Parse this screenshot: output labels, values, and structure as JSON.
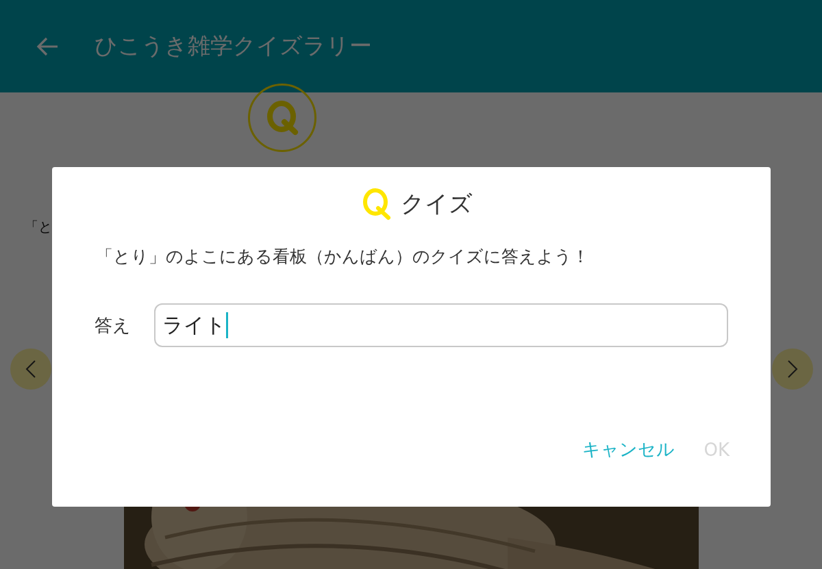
{
  "app_bar": {
    "title": "ひこうき雑学クイズラリー"
  },
  "page": {
    "lead_text": "「と"
  },
  "dialog": {
    "title": "クイズ",
    "question": "「とり」のよこにある看板（かんばん）のクイズに答えよう！",
    "answer_label": "答え",
    "answer_value": "ライト",
    "buttons": [
      {
        "label": "キャンセル",
        "disabled": false
      },
      {
        "label": "OK",
        "disabled": true
      }
    ]
  }
}
